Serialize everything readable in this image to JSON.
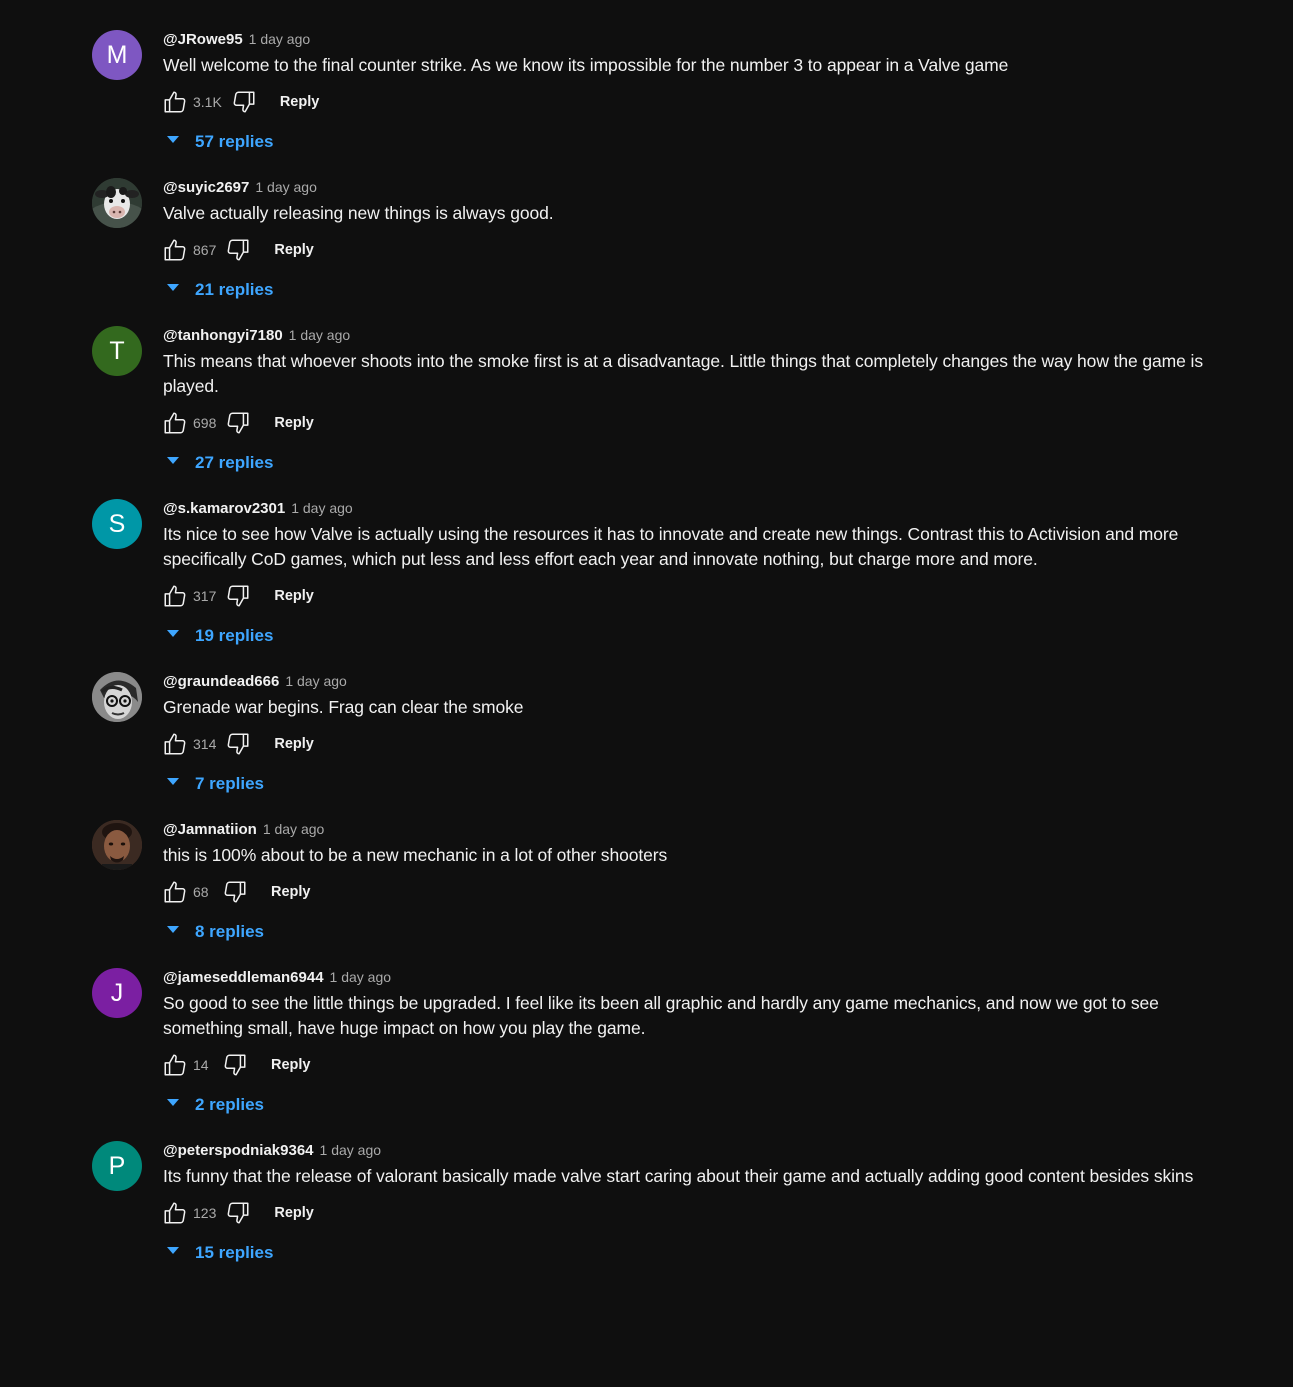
{
  "comments": [
    {
      "author": "@JRowe95",
      "time": "1 day ago",
      "text": "Well welcome to the final counter strike. As we know its impossible for the number 3 to appear in a Valve game",
      "likes": "3.1K",
      "reply_label": "Reply",
      "replies_label": "57 replies",
      "avatar_letter": "M",
      "avatar_color": "#7e57c2",
      "avatar_type": "letter"
    },
    {
      "author": "@suyic2697",
      "time": "1 day ago",
      "text": "Valve actually releasing new things is always good.",
      "likes": "867",
      "reply_label": "Reply",
      "replies_label": "21 replies",
      "avatar_letter": "",
      "avatar_color": "#3a3f3a",
      "avatar_type": "image"
    },
    {
      "author": "@tanhongyi7180",
      "time": "1 day ago",
      "text": "This means that whoever shoots into the smoke first is at a disadvantage. Little things that completely changes the way how the game is played.",
      "likes": "698",
      "reply_label": "Reply",
      "replies_label": "27 replies",
      "avatar_letter": "T",
      "avatar_color": "#33691e",
      "avatar_type": "letter"
    },
    {
      "author": "@s.kamarov2301",
      "time": "1 day ago",
      "text": "Its nice to see how Valve is actually using the resources it has to innovate and create new things. Contrast this to Activision and more specifically CoD games, which put less and less effort each year and innovate nothing, but charge more and more.",
      "likes": "317",
      "reply_label": "Reply",
      "replies_label": "19 replies",
      "avatar_letter": "S",
      "avatar_color": "#0097a7",
      "avatar_type": "letter"
    },
    {
      "author": "@graundead666",
      "time": "1 day ago",
      "text": "Grenade war begins. Frag can clear the smoke",
      "likes": "314",
      "reply_label": "Reply",
      "replies_label": "7 replies",
      "avatar_letter": "",
      "avatar_color": "#6b6b6b",
      "avatar_type": "image"
    },
    {
      "author": "@Jamnatiion",
      "time": "1 day ago",
      "text": "this is 100% about to be a new mechanic in a lot of other shooters",
      "likes": "68",
      "reply_label": "Reply",
      "replies_label": "8 replies",
      "avatar_letter": "",
      "avatar_color": "#5a3a2a",
      "avatar_type": "image"
    },
    {
      "author": "@jameseddleman6944",
      "time": "1 day ago",
      "text": "So good to see the little things be upgraded. I feel like its been all graphic and hardly any game mechanics, and now we got to see something small, have huge impact on how you play the game.",
      "likes": "14",
      "reply_label": "Reply",
      "replies_label": "2 replies",
      "avatar_letter": "J",
      "avatar_color": "#7b1fa2",
      "avatar_type": "letter"
    },
    {
      "author": "@peterspodniak9364",
      "time": "1 day ago",
      "text": "Its funny that the release of valorant basically made valve start caring about their game and actually adding good content besides skins",
      "likes": "123",
      "reply_label": "Reply",
      "replies_label": "15 replies",
      "avatar_letter": "P",
      "avatar_color": "#00897b",
      "avatar_type": "letter"
    }
  ],
  "icons": {
    "like": "thumb-up-icon",
    "dislike": "thumb-down-icon",
    "expand": "caret-down-icon"
  },
  "colors": {
    "background": "#0f0f0f",
    "text": "#f1f1f1",
    "muted": "#aaaaaa",
    "link": "#3ea6ff"
  }
}
